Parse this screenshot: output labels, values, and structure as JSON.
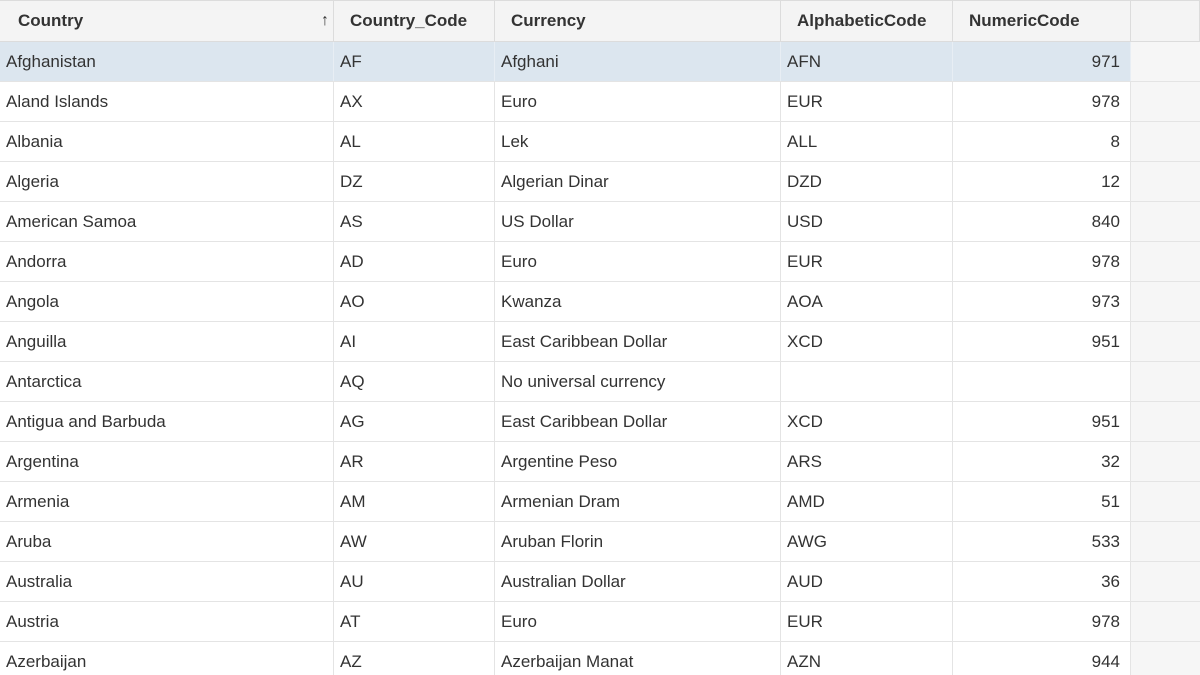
{
  "columns": {
    "country": "Country",
    "country_code": "Country_Code",
    "currency": "Currency",
    "alphabetic_code": "AlphabeticCode",
    "numeric_code": "NumericCode"
  },
  "sort": {
    "column": "Country",
    "direction": "ascending",
    "icon": "arrow-up-icon"
  },
  "selected_row": 0,
  "rows": [
    {
      "country": "Afghanistan",
      "code": "AF",
      "currency": "Afghani",
      "alpha": "AFN",
      "numeric": "971"
    },
    {
      "country": "Aland Islands",
      "code": "AX",
      "currency": "Euro",
      "alpha": "EUR",
      "numeric": "978"
    },
    {
      "country": "Albania",
      "code": "AL",
      "currency": "Lek",
      "alpha": "ALL",
      "numeric": "8"
    },
    {
      "country": "Algeria",
      "code": "DZ",
      "currency": "Algerian Dinar",
      "alpha": "DZD",
      "numeric": "12"
    },
    {
      "country": "American Samoa",
      "code": "AS",
      "currency": "US Dollar",
      "alpha": "USD",
      "numeric": "840"
    },
    {
      "country": "Andorra",
      "code": "AD",
      "currency": "Euro",
      "alpha": "EUR",
      "numeric": "978"
    },
    {
      "country": "Angola",
      "code": "AO",
      "currency": "Kwanza",
      "alpha": "AOA",
      "numeric": "973"
    },
    {
      "country": "Anguilla",
      "code": "AI",
      "currency": "East Caribbean Dollar",
      "alpha": "XCD",
      "numeric": "951"
    },
    {
      "country": "Antarctica",
      "code": "AQ",
      "currency": "No universal currency",
      "alpha": "",
      "numeric": ""
    },
    {
      "country": "Antigua and Barbuda",
      "code": "AG",
      "currency": "East Caribbean Dollar",
      "alpha": "XCD",
      "numeric": "951"
    },
    {
      "country": "Argentina",
      "code": "AR",
      "currency": "Argentine Peso",
      "alpha": "ARS",
      "numeric": "32"
    },
    {
      "country": "Armenia",
      "code": "AM",
      "currency": "Armenian Dram",
      "alpha": "AMD",
      "numeric": "51"
    },
    {
      "country": "Aruba",
      "code": "AW",
      "currency": "Aruban Florin",
      "alpha": "AWG",
      "numeric": "533"
    },
    {
      "country": "Australia",
      "code": "AU",
      "currency": "Australian Dollar",
      "alpha": "AUD",
      "numeric": "36"
    },
    {
      "country": "Austria",
      "code": "AT",
      "currency": "Euro",
      "alpha": "EUR",
      "numeric": "978"
    },
    {
      "country": "Azerbaijan",
      "code": "AZ",
      "currency": "Azerbaijan Manat",
      "alpha": "AZN",
      "numeric": "944"
    }
  ]
}
